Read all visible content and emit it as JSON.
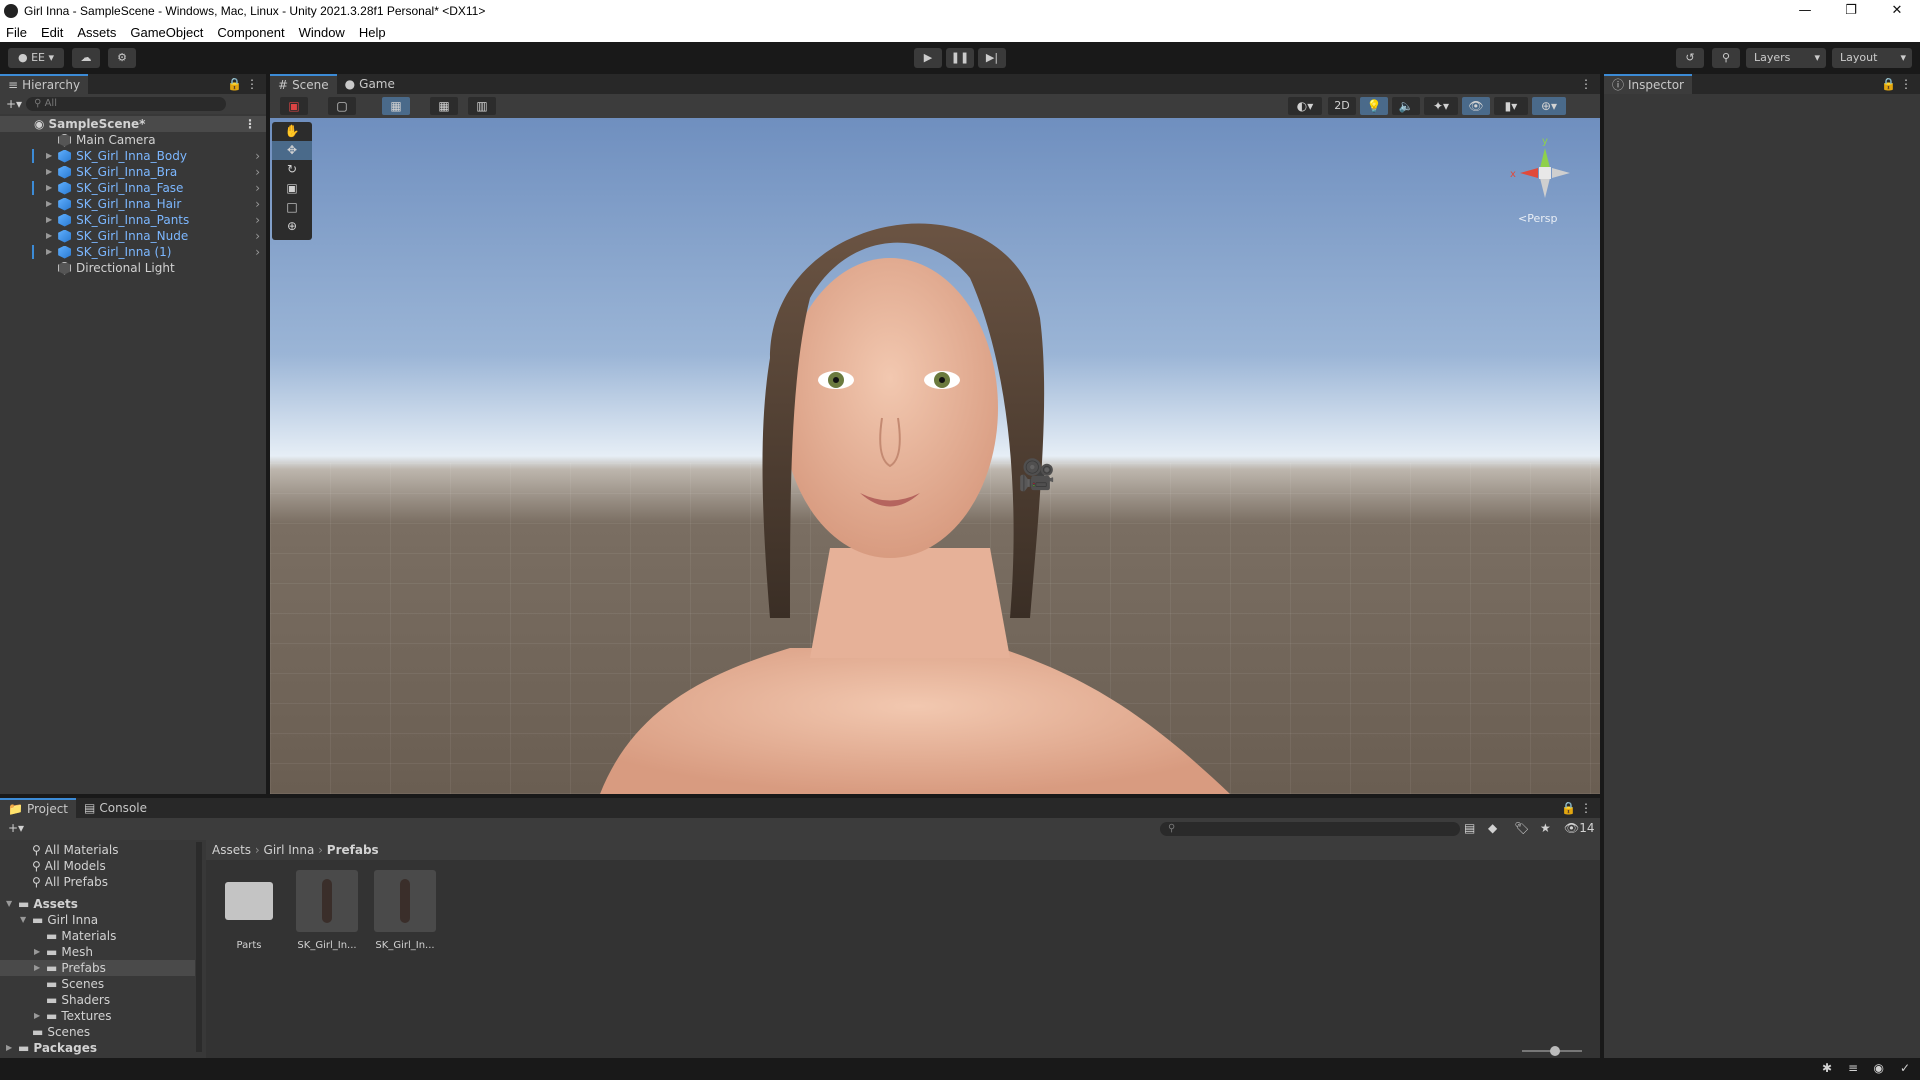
{
  "window": {
    "title": "Girl Inna - SampleScene - Windows, Mac, Linux - Unity 2021.3.28f1 Personal* <DX11>",
    "controls": [
      "minimize-icon",
      "restore-icon",
      "close-icon"
    ]
  },
  "menubar": [
    "File",
    "Edit",
    "Assets",
    "GameObject",
    "Component",
    "Window",
    "Help"
  ],
  "toolbar": {
    "account": "EE",
    "layers": "Layers",
    "layout": "Layout"
  },
  "hierarchy": {
    "tab": "Hierarchy",
    "search_placeholder": "All",
    "scene": "SampleScene*",
    "items": [
      {
        "label": "Main Camera",
        "type": "grey",
        "expandable": false
      },
      {
        "label": "SK_Girl_Inna_Body",
        "type": "blue",
        "expandable": true
      },
      {
        "label": "SK_Girl_Inna_Bra",
        "type": "blue",
        "expandable": true
      },
      {
        "label": "SK_Girl_Inna_Fase",
        "type": "blue",
        "expandable": true
      },
      {
        "label": "SK_Girl_Inna_Hair",
        "type": "blue",
        "expandable": true
      },
      {
        "label": "SK_Girl_Inna_Pants",
        "type": "blue",
        "expandable": true
      },
      {
        "label": "SK_Girl_Inna_Nude",
        "type": "blue",
        "expandable": true
      },
      {
        "label": "SK_Girl_Inna (1)",
        "type": "blue",
        "expandable": true
      },
      {
        "label": "Directional Light",
        "type": "grey",
        "expandable": false
      }
    ]
  },
  "scene": {
    "tabs": [
      "Scene",
      "Game"
    ],
    "btn_2d": "2D",
    "gizmo_label": "<Persp",
    "gizmo_y": "y",
    "gizmo_x": "x"
  },
  "inspector": {
    "tab": "Inspector"
  },
  "project": {
    "tabs": [
      "Project",
      "Console"
    ],
    "search_placeholder": "",
    "hidden_count": "14",
    "breadcrumb": [
      "Assets",
      "Girl Inna",
      "Prefabs"
    ],
    "favorites": [
      "All Materials",
      "All Models",
      "All Prefabs"
    ],
    "tree": [
      {
        "label": "Assets",
        "level": 0,
        "bold": true,
        "open": true
      },
      {
        "label": "Girl Inna",
        "level": 1,
        "open": true
      },
      {
        "label": "Materials",
        "level": 2
      },
      {
        "label": "Mesh",
        "level": 2,
        "arrow": true
      },
      {
        "label": "Prefabs",
        "level": 2,
        "arrow": true,
        "selected": true
      },
      {
        "label": "Scenes",
        "level": 2
      },
      {
        "label": "Shaders",
        "level": 2
      },
      {
        "label": "Textures",
        "level": 2,
        "arrow": true
      },
      {
        "label": "Scenes",
        "level": 1
      },
      {
        "label": "Packages",
        "level": 0,
        "bold": true,
        "arrow": true
      }
    ],
    "assets": [
      {
        "label": "Parts",
        "kind": "folder"
      },
      {
        "label": "SK_Girl_In...",
        "kind": "prefab"
      },
      {
        "label": "SK_Girl_In...",
        "kind": "prefab"
      }
    ]
  }
}
